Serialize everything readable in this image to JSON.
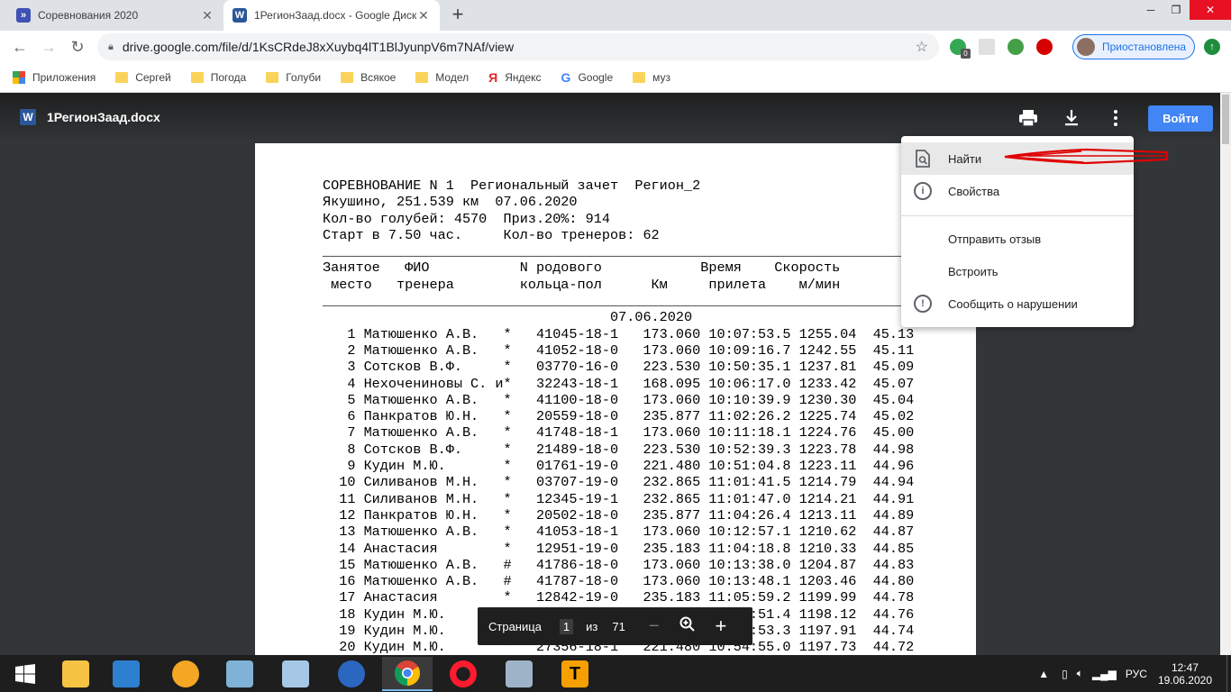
{
  "browser": {
    "tabs": [
      {
        "title": "Соревнования 2020",
        "icon": "google-sites-icon"
      },
      {
        "title": "1РегионЗаад.docx - Google Диск",
        "icon": "word-icon"
      }
    ],
    "url": "drive.google.com/file/d/1KsCRdeJ8xXuybq4lT1BlJyunpV6m7NAf/view",
    "profile_label": "Приостановлена",
    "extension_badge": "0"
  },
  "bookmarks": [
    {
      "label": "Приложения",
      "icon": "apps-grid-icon"
    },
    {
      "label": "Сергей",
      "icon": "folder-icon"
    },
    {
      "label": "Погода",
      "icon": "folder-icon"
    },
    {
      "label": "Голуби",
      "icon": "folder-icon"
    },
    {
      "label": "Всякое",
      "icon": "folder-icon"
    },
    {
      "label": "Модел",
      "icon": "folder-icon"
    },
    {
      "label": "Яндекс",
      "icon": "yandex-icon"
    },
    {
      "label": "Google",
      "icon": "google-icon"
    },
    {
      "label": "муз",
      "icon": "folder-icon"
    }
  ],
  "viewer": {
    "doc_name": "1РегионЗаад.docx",
    "signin_label": "Войти",
    "menu": {
      "find": "Найти",
      "properties": "Свойства",
      "feedback": "Отправить отзыв",
      "embed": "Встроить",
      "report": "Сообщить о нарушении"
    },
    "pagenav": {
      "label": "Страница",
      "current": "1",
      "of": "из",
      "total": "71"
    }
  },
  "document": {
    "header_lines": [
      "СОРЕВНОВАНИЕ N 1  Региональный зачет  Регион_2",
      "Якушино, 251.539 км  07.06.2020",
      "Кол-во голубей: 4570  Приз.20%: 914",
      "Старт в 7.50 час.     Кол-во тренеров: 62"
    ],
    "rule": "_______________________________________________________________________",
    "column_header_1": "Занятое   ФИО           N родового            Время    Скорость",
    "column_header_2": " место   тренера        кольца-пол      Км     прилета    м/мин",
    "date_line": "                                   07.06.2020",
    "rows": [
      "   1 Матюшенко А.В.   *   41045-18-1   173.060 10:07:53.5 1255.04  45.13",
      "   2 Матюшенко А.В.   *   41052-18-0   173.060 10:09:16.7 1242.55  45.11",
      "   3 Сотсков В.Ф.     *   03770-16-0   223.530 10:50:35.1 1237.81  45.09",
      "   4 Нехочениновы С. и*   32243-18-1   168.095 10:06:17.0 1233.42  45.07",
      "   5 Матюшенко А.В.   *   41100-18-0   173.060 10:10:39.9 1230.30  45.04",
      "   6 Панкратов Ю.Н.   *   20559-18-0   235.877 11:02:26.2 1225.74  45.02",
      "   7 Матюшенко А.В.   *   41748-18-1   173.060 10:11:18.1 1224.76  45.00",
      "   8 Сотсков В.Ф.     *   21489-18-0   223.530 10:52:39.3 1223.78  44.98",
      "   9 Кудин М.Ю.       *   01761-19-0   221.480 10:51:04.8 1223.11  44.96",
      "  10 Силиванов М.Н.   *   03707-19-0   232.865 11:01:41.5 1214.79  44.94",
      "  11 Силиванов М.Н.   *   12345-19-1   232.865 11:01:47.0 1214.21  44.91",
      "  12 Панкратов Ю.Н.   *   20502-18-0   235.877 11:04:26.4 1213.11  44.89",
      "  13 Матюшенко А.В.   *   41053-18-1   173.060 10:12:57.1 1210.62  44.87",
      "  14 Анастасия        *   12951-19-0   235.183 11:04:18.8 1210.33  44.85",
      "  15 Матюшенко А.В.   #   41786-18-0   173.060 10:13:38.0 1204.87  44.83",
      "  16 Матюшенко А.В.   #   41787-18-0   173.060 10:13:48.1 1203.46  44.80",
      "  17 Анастасия        *   12842-19-0   235.183 11:05:59.2 1199.99  44.78",
      "  18 Кудин М.Ю.       *   27331-18-0   221.480 10:54:51.4 1198.12  44.76",
      "  19 Кудин М.Ю.       *   27270-18-0   221.480 10:54:53.3 1197.91  44.74",
      "  20 Кудин М.Ю.       *   27356-18-1   221.480 10:54:55.0 1197.73  44.72"
    ]
  },
  "taskbar": {
    "apps": [
      "start",
      "file-explorer",
      "media-player",
      "fl-studio",
      "notepad",
      "paint",
      "thunderbird",
      "chrome",
      "opera",
      "calculator",
      "app-t"
    ],
    "lang": "РУС",
    "time": "12:47",
    "date": "19.06.2020"
  },
  "colors": {
    "accent": "#4285f4",
    "annotation": "#e00000",
    "tab_bg": "#dee1e6",
    "viewer_bg": "#323639"
  }
}
